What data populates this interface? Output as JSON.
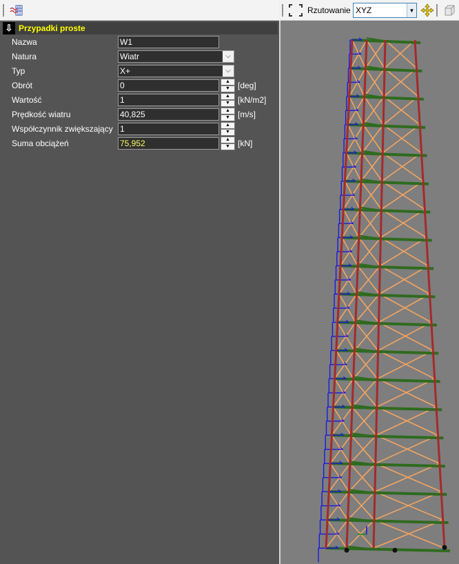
{
  "toolbar": {
    "left_icon": "wave-grid-icon"
  },
  "view_toolbar": {
    "frame_icon": "selection-frame-icon",
    "projection_label": "Rzutowanie",
    "projection_value": "XYZ",
    "pan_icon": "move-arrows-icon",
    "view3d_icon": "3d-box-icon"
  },
  "panel": {
    "section_title": "Przypadki proste",
    "rows": [
      {
        "label": "Nazwa",
        "value": "W1",
        "control": "text"
      },
      {
        "label": "Natura",
        "value": "Wiatr",
        "control": "dropdown"
      },
      {
        "label": "Typ",
        "value": "X+",
        "control": "dropdown"
      },
      {
        "label": "Obrót",
        "value": "0",
        "control": "spin",
        "unit": "[deg]"
      },
      {
        "label": "Wartość",
        "value": "1",
        "control": "spin",
        "unit": "[kN/m2]"
      },
      {
        "label": "Prędkość wiatru",
        "value": "40,825",
        "control": "spin",
        "unit": "[m/s]"
      },
      {
        "label": "Współczynnik zwiększający",
        "value": "1",
        "control": "spin",
        "unit": ""
      },
      {
        "label": "Suma obciążeń",
        "value": "75,952",
        "control": "spin",
        "unit": "[kN]"
      }
    ]
  },
  "colors": {
    "panel_bg": "#545454",
    "header_text": "#ffff00",
    "viewport_bg": "#7e7e7e",
    "column_red": "#a52a2a",
    "bracing_orange": "#f4a460",
    "beam_green": "#2e6b1e",
    "wind_load_blue": "#1a1adc"
  }
}
